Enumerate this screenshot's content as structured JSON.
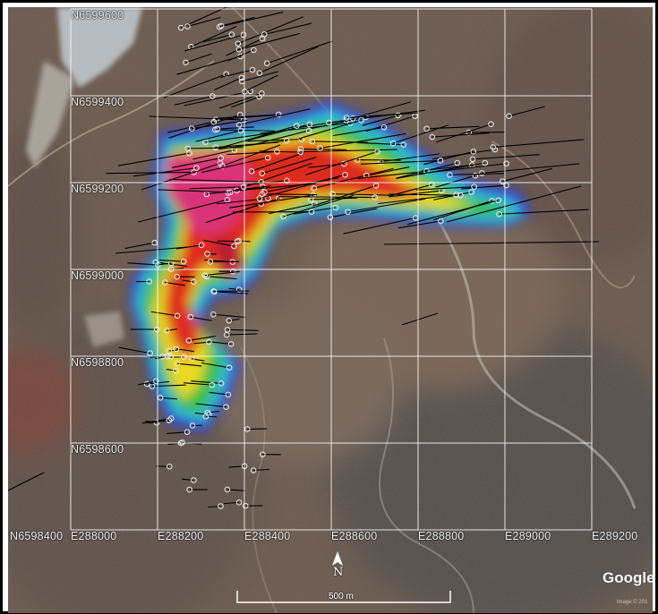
{
  "map": {
    "northing_labels": [
      "N6599600",
      "N6599400",
      "N6599200",
      "N6599000",
      "N6598800",
      "N6598600",
      "N6598400"
    ],
    "easting_labels": [
      "E288000",
      "E288200",
      "E288400",
      "E288600",
      "E288800",
      "E289000",
      "E289200"
    ],
    "north_arrow": "N",
    "scale_bar": "500 m",
    "attribution": "Google",
    "imagery_credit": "Image © 201"
  },
  "colors": {
    "grid": "#ffffff",
    "heat_high": "#e0307a",
    "heat_red": "#e0281e",
    "heat_yellow": "#f0e020",
    "heat_green": "#30c040",
    "heat_cyan": "#30c8d8",
    "heat_blue": "#3040e0",
    "drill_trace": "#000000"
  }
}
